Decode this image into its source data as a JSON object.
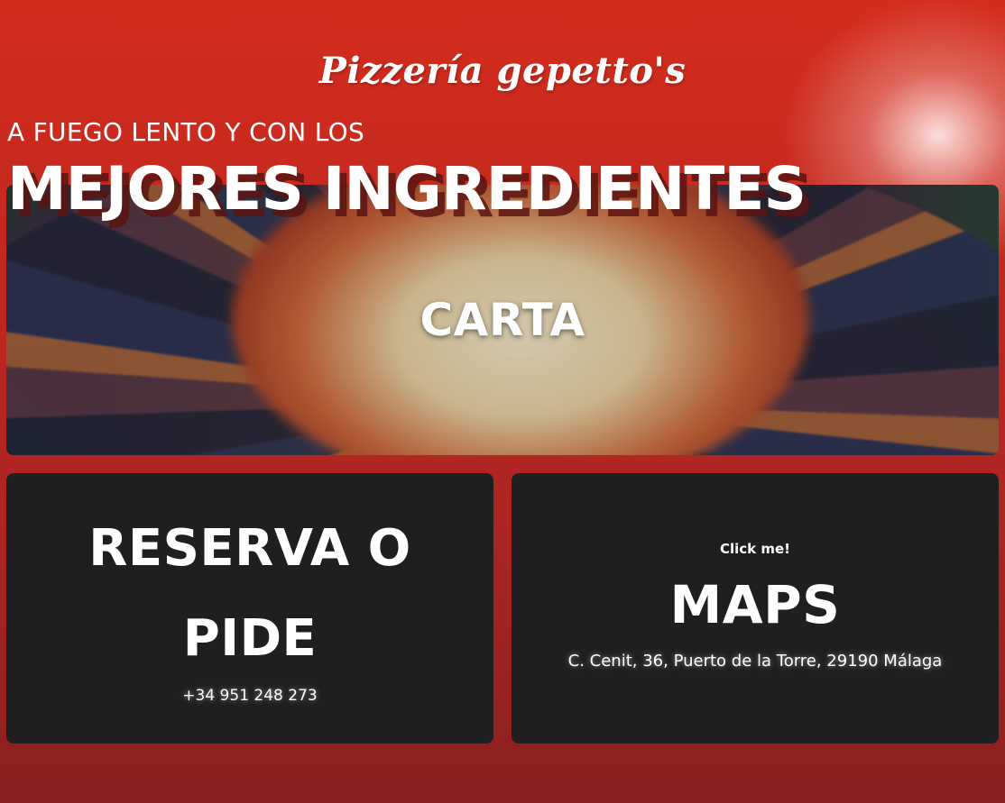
{
  "header": {
    "brand": "Pizzería gepetto's",
    "tagline": "A FUEGO LENTO Y CON LOS",
    "headline": "MEJORES INGREDIENTES"
  },
  "hero": {
    "label": "CARTA"
  },
  "reserva": {
    "title_line1": "RESERVA O",
    "title_line2": "PIDE",
    "phone": "+34 951 248 273"
  },
  "maps": {
    "hint": "Click me!",
    "title": "MAPS",
    "address": "C. Cenit, 36, Puerto de la Torre, 29190 Málaga"
  },
  "colors": {
    "background_top": "#d42d1e",
    "background_bottom": "#8a2020",
    "card": "#1f1f1f",
    "text": "#ffffff"
  }
}
